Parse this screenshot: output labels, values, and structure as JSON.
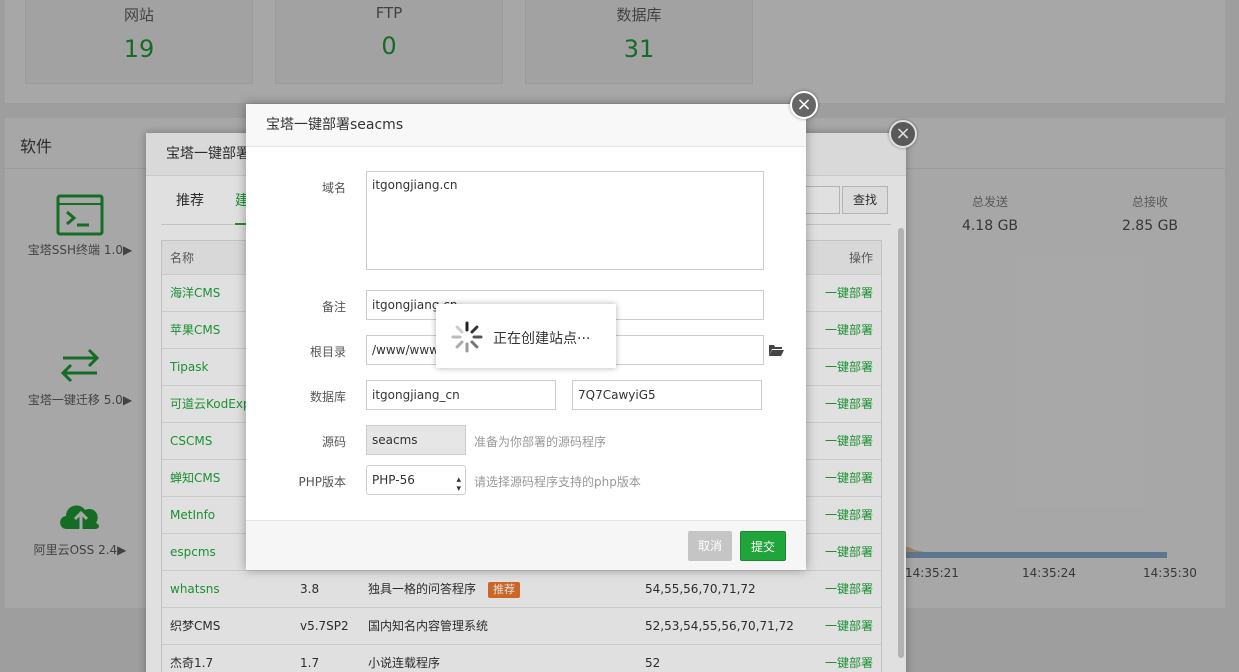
{
  "stats": [
    {
      "label": "网站",
      "value": "19"
    },
    {
      "label": "FTP",
      "value": "0"
    },
    {
      "label": "数据库",
      "value": "31"
    }
  ],
  "software": {
    "title": "软件",
    "tools": [
      {
        "name": "宝塔SSH终端 1.0▶"
      },
      {
        "name": "宝塔一键迁移 5.0▶"
      },
      {
        "name": "阿里云OSS 2.4▶"
      }
    ]
  },
  "network": {
    "sent_label": "总发送",
    "sent_value": "4.18 GB",
    "recv_label": "总接收",
    "recv_value": "2.85 GB",
    "times": [
      "14:35:21",
      "14:35:24",
      "14:35:30"
    ]
  },
  "back_modal": {
    "title": "宝塔一键部署",
    "tabs": [
      "推荐",
      "建"
    ],
    "search_button": "查找",
    "columns": {
      "name": "名称",
      "action": "操作"
    },
    "rows": [
      {
        "name": "海洋CMS",
        "version": "",
        "desc": "",
        "php": "",
        "action": "一键部署",
        "green": true
      },
      {
        "name": "苹果CMS",
        "version": "",
        "desc": "",
        "php": "",
        "action": "一键部署",
        "green": true
      },
      {
        "name": "Tipask",
        "version": "",
        "desc": "",
        "php": "",
        "action": "一键部署",
        "green": true
      },
      {
        "name": "可道云KodExp",
        "version": "",
        "desc": "",
        "php": "",
        "action": "一键部署",
        "green": true
      },
      {
        "name": "CSCMS",
        "version": "",
        "desc": "",
        "php": "",
        "action": "一键部署",
        "green": true
      },
      {
        "name": "蝉知CMS",
        "version": "",
        "desc": "",
        "php": "",
        "action": "一键部署",
        "green": true
      },
      {
        "name": "MetInfo",
        "version": "",
        "desc": "",
        "php": "",
        "action": "一键部署",
        "green": true
      },
      {
        "name": "espcms",
        "version": "",
        "desc": "",
        "php": "",
        "action": "一键部署",
        "green": true
      },
      {
        "name": "whatsns",
        "version": "3.8",
        "desc": "独具一格的问答程序",
        "tag": "推荐",
        "php": "54,55,56,70,71,72",
        "action": "一键部署",
        "green": true
      },
      {
        "name": "织梦CMS",
        "version": "v5.7SP2",
        "desc": "国内知名内容管理系统",
        "php": "52,53,54,55,56,70,71,72",
        "action": "一键部署",
        "green": false
      },
      {
        "name": "杰奇1.7",
        "version": "1.7",
        "desc": "小说连载程序",
        "php": "52",
        "action": "一键部署",
        "green": false
      }
    ]
  },
  "front_modal": {
    "title": "宝塔一键部署seacms",
    "domain_label": "域名",
    "domain_value": "itgongjiang.cn",
    "note_label": "备注",
    "note_value": "itgongjiang.cn",
    "root_label": "根目录",
    "root_value": "/www/wwwroot/itgongjiang.cn",
    "db_label": "数据库",
    "db_user": "itgongjiang_cn",
    "db_pass": "7Q7CawyiG5",
    "source_label": "源码",
    "source_value": "seacms",
    "source_hint": "准备为你部署的源码程序",
    "php_label": "PHP版本",
    "php_value": "PHP-56",
    "php_hint": "请选择源码程序支持的php版本",
    "cancel": "取消",
    "submit": "提交"
  },
  "loading": {
    "text": "正在创建站点···"
  },
  "colors": {
    "accent": "#20a53a",
    "tag": "#e8752a"
  }
}
